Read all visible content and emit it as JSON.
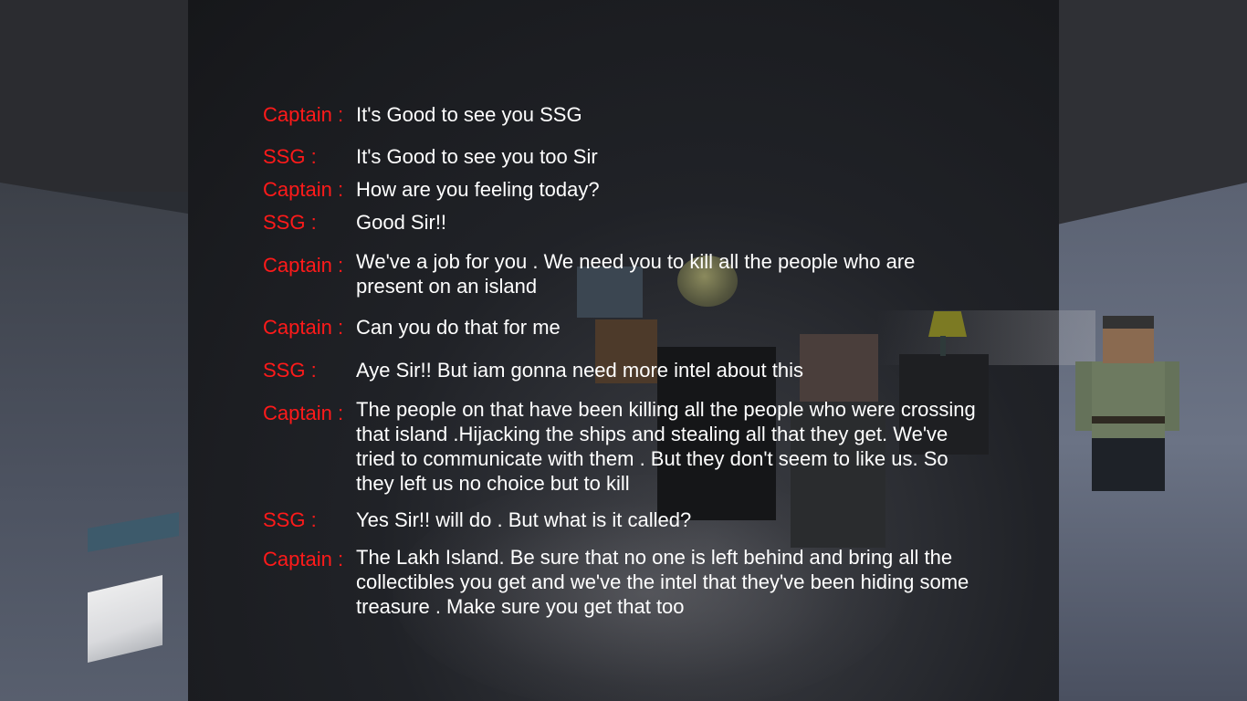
{
  "dialogue": [
    {
      "speaker": "Captain :",
      "text": "It's Good to see you SSG"
    },
    {
      "speaker": "SSG :",
      "text": "It's Good to see you too Sir"
    },
    {
      "speaker": "Captain :",
      "text": "How are you feeling today?"
    },
    {
      "speaker": "SSG :",
      "text": "Good Sir!!"
    },
    {
      "speaker": "Captain :",
      "text": "We've a job for you . We need you to kill all the people who are present on an island"
    },
    {
      "speaker": "Captain :",
      "text": "Can you do that for me"
    },
    {
      "speaker": "SSG :",
      "text": "Aye Sir!! But iam gonna need more intel about this"
    },
    {
      "speaker": "Captain :",
      "text": "The people on that have been killing all the people who were crossing that island .Hijacking the ships and stealing all that they get. We've tried to communicate with them . But they don't seem to like us. So they left us no choice but to kill"
    },
    {
      "speaker": "SSG :",
      "text": "Yes Sir!! will do . But what is it called?"
    },
    {
      "speaker": "Captain :",
      "text": "The Lakh Island. Be sure that no one is left behind and bring all the collectibles you get and we've the intel that they've been hiding some treasure . Make sure you get that too"
    }
  ],
  "colors": {
    "speaker": "#ff1a1a",
    "text": "#ffffff"
  }
}
